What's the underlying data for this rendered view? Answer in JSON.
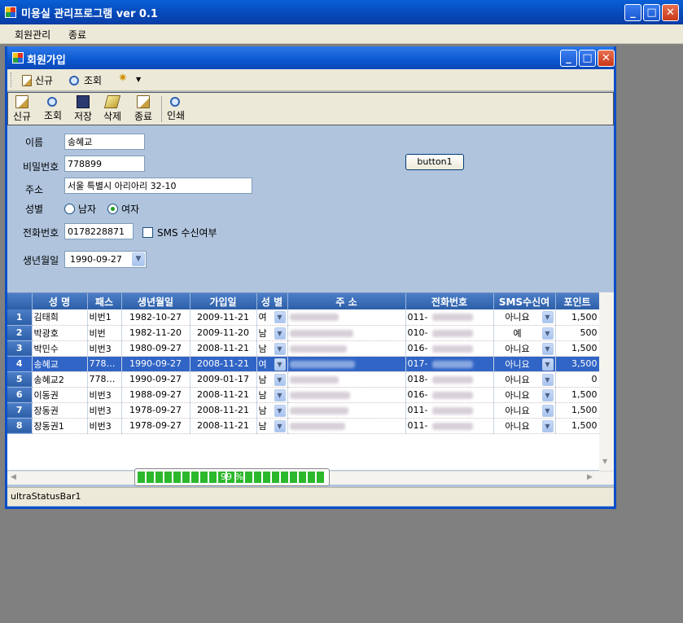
{
  "app": {
    "title": "미용실 관리프로그램 ver 0.1",
    "menu": [
      "회원관리",
      "종료"
    ]
  },
  "form": {
    "title": "회원가입",
    "toolbar1": {
      "new": "신규",
      "search": "조회"
    },
    "toolbar2": [
      "신규",
      "조회",
      "저장",
      "삭제",
      "종료",
      "인쇄"
    ],
    "labels": {
      "name": "이름",
      "password": "비밀번호",
      "address": "주소",
      "gender": "성별",
      "male": "남자",
      "female": "여자",
      "phone": "전화번호",
      "sms": "SMS 수신여부",
      "birth": "생년월일"
    },
    "values": {
      "name": "송혜교",
      "password": "778899",
      "address": "서울 특별시 아리아리 32-10",
      "phone": "0178228871",
      "birth": "1990-09-27",
      "gender_selected": "female",
      "sms_checked": false
    },
    "button1": "button1"
  },
  "grid": {
    "columns": [
      "성 명",
      "패스",
      "생년월일",
      "가입일",
      "성 별",
      "주 소",
      "전화번호",
      "SMS수신여",
      "포인트"
    ],
    "rows": [
      {
        "no": "1",
        "name": "김태희",
        "pass": "비번1",
        "birth": "1982-10-27",
        "join": "2009-11-21",
        "gender": "여",
        "phone": "011-",
        "sms": "아니요",
        "point": "1,500"
      },
      {
        "no": "2",
        "name": "박광호",
        "pass": "비번",
        "birth": "1982-11-20",
        "join": "2009-11-20",
        "gender": "남",
        "phone": "010-",
        "sms": "예",
        "point": "500"
      },
      {
        "no": "3",
        "name": "박민수",
        "pass": "비번3",
        "birth": "1980-09-27",
        "join": "2008-11-21",
        "gender": "남",
        "phone": "016-",
        "sms": "아니요",
        "point": "1,500"
      },
      {
        "no": "4",
        "name": "송혜교",
        "pass": "778…",
        "birth": "1990-09-27",
        "join": "2008-11-21",
        "gender": "여",
        "phone": "017-",
        "sms": "아니요",
        "point": "3,500"
      },
      {
        "no": "5",
        "name": "송혜교2",
        "pass": "778…",
        "birth": "1990-09-27",
        "join": "2009-01-17",
        "gender": "남",
        "phone": "018-",
        "sms": "아니요",
        "point": "0"
      },
      {
        "no": "6",
        "name": "이동권",
        "pass": "비번3",
        "birth": "1988-09-27",
        "join": "2008-11-21",
        "gender": "남",
        "phone": "016-",
        "sms": "아니요",
        "point": "1,500"
      },
      {
        "no": "7",
        "name": "장동권",
        "pass": "비번3",
        "birth": "1978-09-27",
        "join": "2008-11-21",
        "gender": "남",
        "phone": "011-",
        "sms": "아니요",
        "point": "1,500"
      },
      {
        "no": "8",
        "name": "장동권1",
        "pass": "비번3",
        "birth": "1978-09-27",
        "join": "2008-11-21",
        "gender": "남",
        "phone": "011-",
        "sms": "아니요",
        "point": "1,500"
      }
    ],
    "selected_row": 4
  },
  "progress": {
    "label": "99 %",
    "value": 0.99
  },
  "status": {
    "text": "ultraStatusBar1"
  },
  "colors": {
    "titlebar": "#0a5fd6",
    "form_bg": "#b0c4de",
    "grid_header": "#3d6fb8",
    "selection": "#3165c5",
    "progress": "#2cb82c"
  }
}
